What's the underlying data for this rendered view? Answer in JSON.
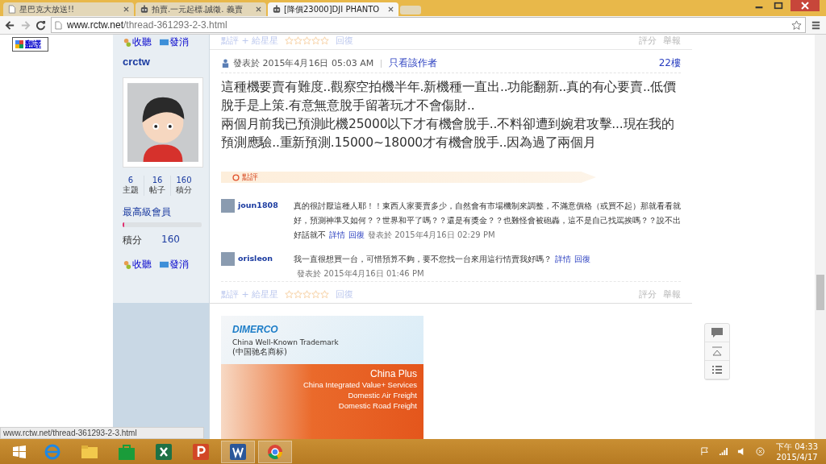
{
  "browser": {
    "tabs": [
      {
        "title": "星巴克大放送!!",
        "selected": false,
        "kind": "page"
      },
      {
        "title": "拍賣.一元起標.誠徵. 義賣",
        "selected": false,
        "kind": "robot"
      },
      {
        "title": "[降價23000]DJI PHANTO",
        "selected": true,
        "kind": "robot"
      }
    ],
    "url_host": "www.rctw.net",
    "url_path": "/thread-361293-2-3.html",
    "status_url": "www.rctw.net/thread-361293-2-3.html"
  },
  "translate": {
    "label": "翻譯"
  },
  "previous_post": {
    "follow": "收聽",
    "message": "發消",
    "rate": "點評 + 給星星",
    "stars": 0,
    "reply": "回復",
    "score": "評分",
    "report": "舉報"
  },
  "post": {
    "author": "crctw",
    "stats": [
      {
        "value": "6",
        "label": "主題"
      },
      {
        "value": "16",
        "label": "帖子"
      },
      {
        "value": "160",
        "label": "積分"
      }
    ],
    "rank": "最高級會員",
    "rank_bar": {
      "level": 0.02
    },
    "points_label": "積分",
    "points": "160",
    "follow": "收聽",
    "message": "發消",
    "posted": "發表於 2015年4月16日 05:03 AM",
    "only_author": "只看該作者",
    "floor": "22樓",
    "body": [
      "這種機要賣有難度..觀察空拍機半年.新機種一直出..功能翻新..真的有心要賣..低價脫手是上策.有意無意脫手留著玩才不會傷財..",
      "兩個月前我已預測此機25000以下才有機會脫手..不料卻遭到婉君攻擊...現在我的預測應驗..重新預測.15000~18000才有機會脫手..因為過了兩個月"
    ],
    "comments_label": "點評",
    "comments": [
      {
        "user": "joun1808",
        "text": "真的很討厭這種人耶！！東西人家要賣多少，自然會有市場機制來調整，不滿意價格（或買不起）那就看看就好，預測神準又如何？？世界和平了嗎？？還是有獎金？？也難怪會被砲轟，這不是自己找罵挨嗎？？說不出好話就不",
        "detail": "詳情",
        "reply": "回復",
        "time": "發表於 2015年4月16日 02:29 PM"
      },
      {
        "user": "orisleon",
        "text": "我一直很想買一台，可惜預算不夠，要不您找一台來用這行情賣我好嗎？",
        "detail": "詳情",
        "reply": "回復",
        "time": "發表於 2015年4月16日 01:46 PM"
      }
    ],
    "rate": "點評 + 給星星",
    "stars": 0,
    "reply": "回復",
    "score": "評分",
    "report": "舉報"
  },
  "ad": {
    "brand": "DIMERCO",
    "tagline": "China Well-Known Trademark",
    "tagline_cn": "(中国驰名商标)",
    "headline": "China Plus",
    "services": [
      "China Integrated Value+ Services",
      "Domestic Air Freight",
      "Domestic Road Freight"
    ]
  },
  "taskbar": {
    "apps": [
      {
        "kind": "ie",
        "selected": false
      },
      {
        "kind": "explorer",
        "selected": false
      },
      {
        "kind": "store",
        "selected": false
      },
      {
        "kind": "excel",
        "selected": false
      },
      {
        "kind": "powerpoint",
        "selected": false
      },
      {
        "kind": "word",
        "selected": true
      },
      {
        "kind": "chrome",
        "selected": true
      }
    ],
    "time": "下午 04:33",
    "date": "2015/4/17"
  }
}
